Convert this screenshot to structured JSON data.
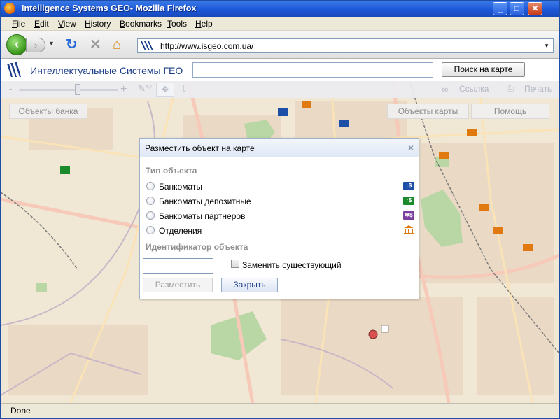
{
  "window": {
    "title": "Intelligence Systems GEO- Mozilla Firefox"
  },
  "menu": [
    {
      "label": "File",
      "key": "F",
      "rest": "ile"
    },
    {
      "label": "Edit",
      "key": "E",
      "rest": "dit"
    },
    {
      "label": "View",
      "key": "V",
      "rest": "iew"
    },
    {
      "label": "History",
      "key": "H",
      "rest": "istory"
    },
    {
      "label": "Bookmarks",
      "key": "B",
      "rest": "ookmarks"
    },
    {
      "label": "Tools",
      "key": "T",
      "rest": "ools"
    },
    {
      "label": "Help",
      "key": "H",
      "rest": "elp"
    }
  ],
  "address": {
    "url": "http://www.isgeo.com.ua/"
  },
  "site": {
    "name": "Интеллектуальные Системы ГЕО",
    "search_value": "",
    "search_button": "Поиск на карте"
  },
  "toolbar": {
    "zoom_minus": "-",
    "zoom_plus": "+",
    "coord_label": "x,y",
    "link_label": "Ссылка",
    "print_label": "Печать",
    "zoom_level": 0.6
  },
  "map_panel": {
    "bank_objects": "Объекты банка",
    "map_objects": "Объекты карты",
    "help": "Помощь"
  },
  "dialog": {
    "title": "Разместить объект на карте",
    "close": "×",
    "type_section": "Тип объекта",
    "options": [
      {
        "label": "Банкоматы",
        "icon": "atm-icon",
        "color": "#1e4fa8",
        "glyph": "↓$"
      },
      {
        "label": "Банкоматы депозитные",
        "icon": "deposit-atm-icon",
        "color": "#1a8a2a",
        "glyph": "↑$"
      },
      {
        "label": "Банкоматы партнеров",
        "icon": "partner-atm-icon",
        "color": "#7b3fa0",
        "glyph": "✱$"
      },
      {
        "label": "Отделения",
        "icon": "branch-icon",
        "color": "#e07a10",
        "glyph": ""
      }
    ],
    "id_section": "Идентификатор объекта",
    "id_value": "",
    "replace_label": "Заменить существующий",
    "place_button": "Разместить",
    "close_button": "Закрыть"
  },
  "status": {
    "text": "Done"
  },
  "colors": {
    "accent": "#1d3e8a",
    "titlebar": "#1b56d6",
    "map_bg": "#f0e7d5"
  }
}
